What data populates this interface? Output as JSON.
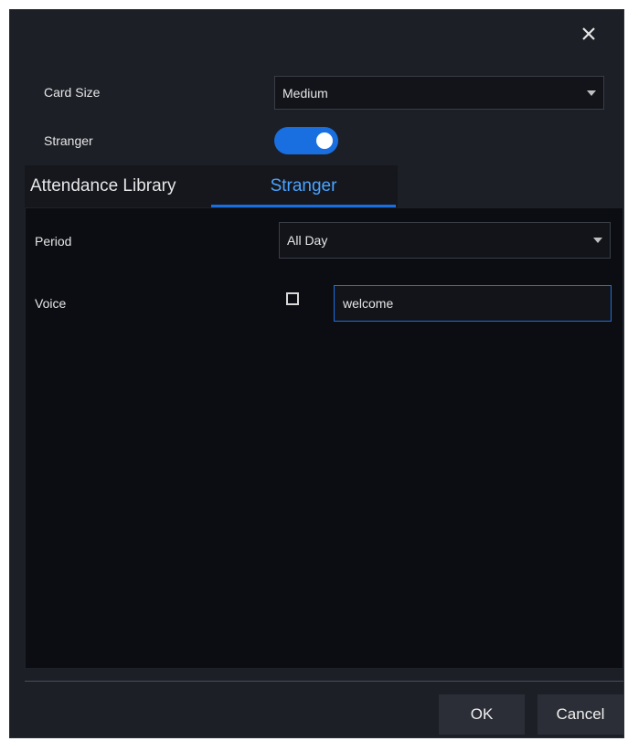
{
  "dialog": {
    "close_icon": "close-icon"
  },
  "settings": {
    "card_size_label": "Card Size",
    "card_size_value": "Medium",
    "stranger_label": "Stranger",
    "stranger_enabled": true
  },
  "tabs": [
    {
      "label": "Attendance Library",
      "active": false
    },
    {
      "label": "Stranger",
      "active": true
    }
  ],
  "stranger_panel": {
    "period_label": "Period",
    "period_value": "All Day",
    "voice_label": "Voice",
    "voice_checked": false,
    "voice_text": "welcome"
  },
  "footer": {
    "ok_label": "OK",
    "cancel_label": "Cancel"
  },
  "colors": {
    "accent": "#1a6fe0",
    "active_tab_text": "#4aa3ff",
    "background": "#1c1f26"
  }
}
